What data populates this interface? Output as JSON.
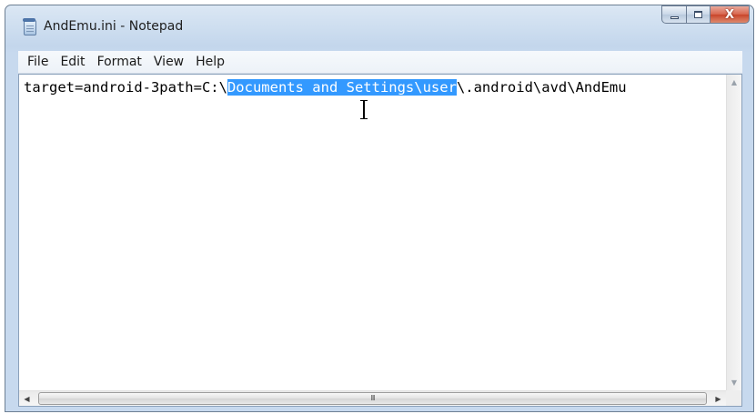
{
  "window": {
    "title": "AndEmu.ini - Notepad"
  },
  "controls": {
    "minimize_icon": "minimize-icon",
    "maximize_icon": "maximize-icon",
    "close_label": "X"
  },
  "menubar": {
    "items": [
      "File",
      "Edit",
      "Format",
      "View",
      "Help"
    ]
  },
  "editor": {
    "text_before_selection": "target=android-3path=C:\\",
    "selected_text": "Documents and Settings\\user",
    "text_after_selection": "\\.android\\avd\\AndEmu",
    "selection_color": "#3399ff"
  },
  "scrollbar": {
    "thumb_grip": "III"
  }
}
